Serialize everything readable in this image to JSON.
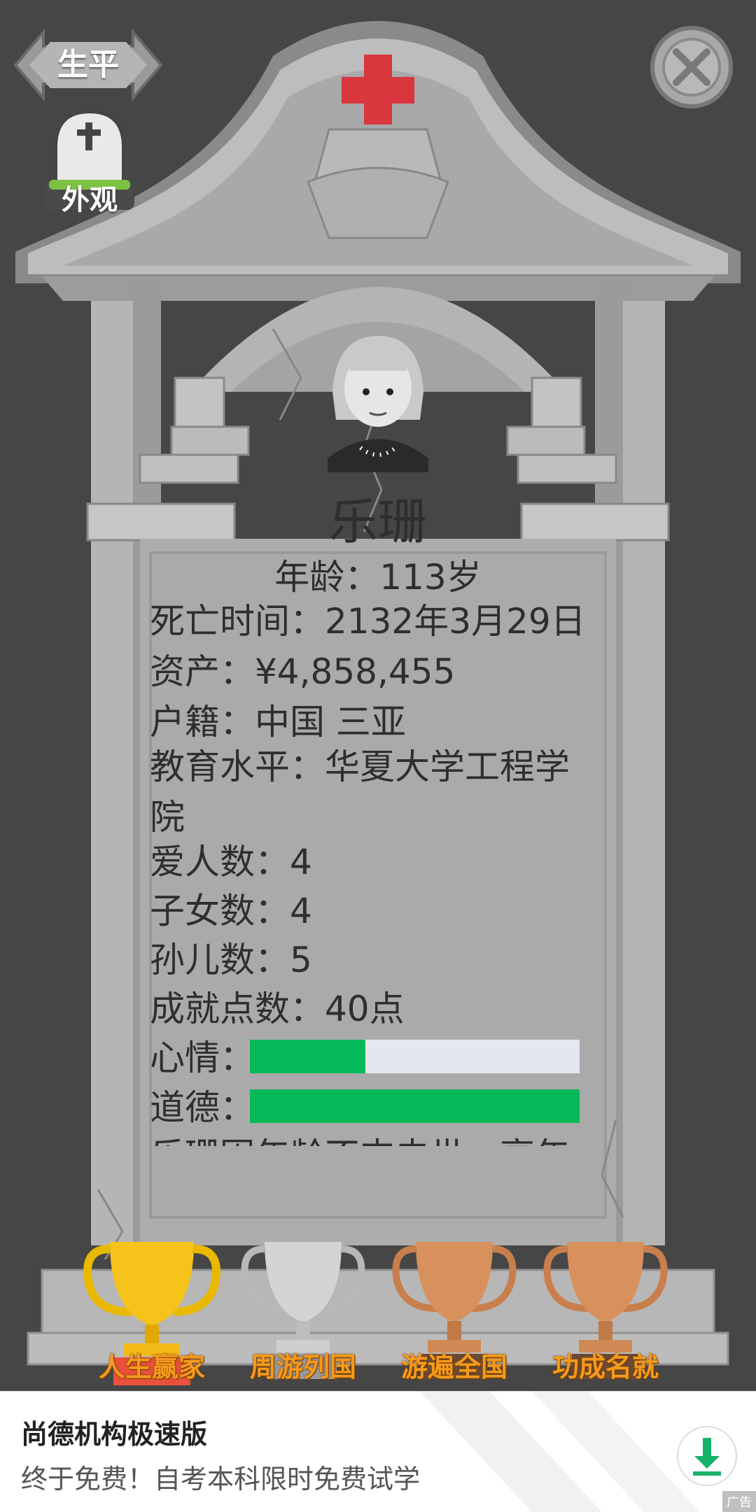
{
  "header": {
    "back_label": "生平",
    "appearance_label": "外观"
  },
  "epitaph": {
    "name": "乐珊",
    "age": "年龄：113岁",
    "rows": {
      "death_time": "死亡时间：2132年3月29日",
      "assets": "资产：¥4,858,455",
      "hukou": "户籍：中国 三亚",
      "education": "教育水平：华夏大学工程学院",
      "spouses": "爱人数：4",
      "children": "子女数：4",
      "grandchildren": "孙儿数：5",
      "achievement_points": "成就点数：40点"
    },
    "mood_label": "心情：",
    "mood_level": 0.35,
    "morality_label": "道德：",
    "morality_level": 1.0,
    "clipped_text": "乐珊因年龄不支去世，享年"
  },
  "trophies": [
    {
      "label": "人生赢家",
      "tier": "gold"
    },
    {
      "label": "周游列国",
      "tier": "silver"
    },
    {
      "label": "游遍全国",
      "tier": "bronze"
    },
    {
      "label": "功成名就",
      "tier": "bronze"
    }
  ],
  "ad": {
    "title": "尚德机构极速版",
    "description": "终于免费！自考本科限时免费试学",
    "mark": "广告"
  },
  "colors": {
    "background": "#464646",
    "stone": "#adadad",
    "bar_fill": "#04b95a",
    "bar_track": "#e3e8f0",
    "cross": "#d9363e",
    "trophy_label": "#f49a1c"
  },
  "icons": {
    "close": "close-icon",
    "cross": "red-cross-icon",
    "download": "download-icon"
  }
}
